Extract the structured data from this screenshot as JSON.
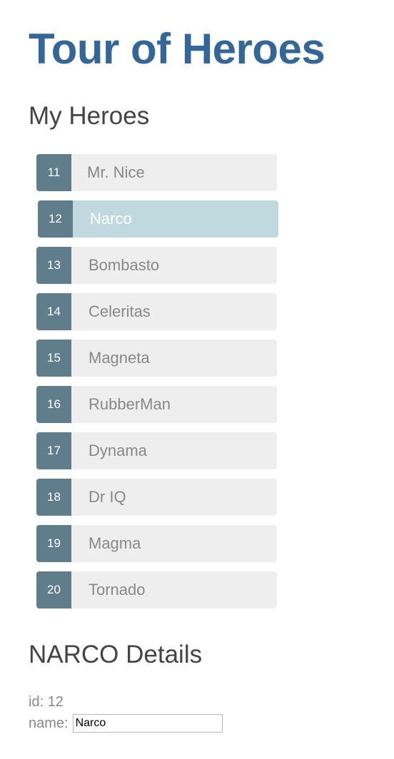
{
  "app": {
    "title": "Tour of Heroes"
  },
  "heroes_section": {
    "title": "My Heroes",
    "selected_index": 1,
    "items": [
      {
        "id": "11",
        "name": "Mr. Nice"
      },
      {
        "id": "12",
        "name": "Narco"
      },
      {
        "id": "13",
        "name": "Bombasto"
      },
      {
        "id": "14",
        "name": "Celeritas"
      },
      {
        "id": "15",
        "name": "Magneta"
      },
      {
        "id": "16",
        "name": "RubberMan"
      },
      {
        "id": "17",
        "name": "Dynama"
      },
      {
        "id": "18",
        "name": "Dr IQ"
      },
      {
        "id": "19",
        "name": "Magma"
      },
      {
        "id": "20",
        "name": "Tornado"
      }
    ]
  },
  "details": {
    "title": "NARCO Details",
    "id_label": "id:",
    "id_value": "12",
    "name_label": "name:",
    "name_value": "Narco"
  },
  "colors": {
    "title": "#336699",
    "badge": "#607d8b",
    "item_bg": "#eeeeee",
    "selected_bg": "#bfd9de"
  }
}
